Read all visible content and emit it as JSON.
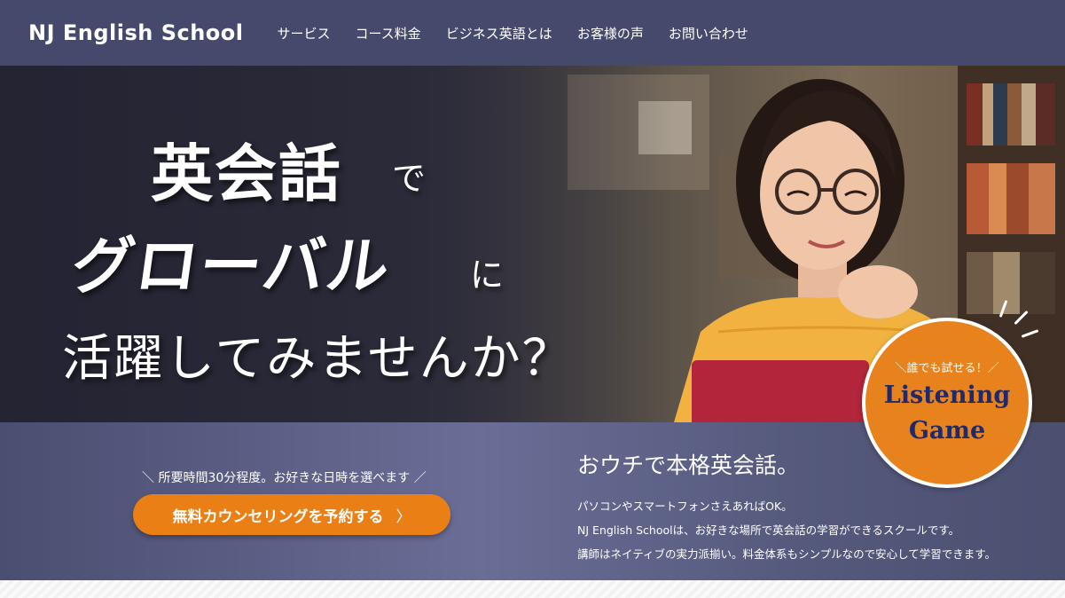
{
  "header": {
    "logo": "NJ English School",
    "nav": [
      "サービス",
      "コース料金",
      "ビジネス英語とは",
      "お客様の声",
      "お問い合わせ"
    ]
  },
  "hero": {
    "line1_big": "英会話",
    "line1_small": "で",
    "line2_big": "グローバル",
    "line2_small": "に",
    "line3": "活躍してみませんか？"
  },
  "badge": {
    "subtitle": "＼誰でも試せる！／",
    "title_line1": "Listening",
    "title_line2": "Game"
  },
  "cta": {
    "note": "＼ 所要時間30分程度。お好きな日時を選べます ／",
    "button_label": "無料カウンセリングを予約する",
    "arrow": "〉"
  },
  "intro": {
    "title": "おウチで本格英会話。",
    "lines": [
      "パソコンやスマートフォンさえあればOK。",
      "NJ English Schoolは、お好きな場所で英会話の学習ができるスクールです。",
      "講師はネイティブの実力派揃い。料金体系もシンプルなので安心して学習できます。"
    ]
  },
  "colors": {
    "header_bg": "#454a6c",
    "accent_orange": "#ea7f16",
    "badge_text": "#1f2a6e"
  }
}
